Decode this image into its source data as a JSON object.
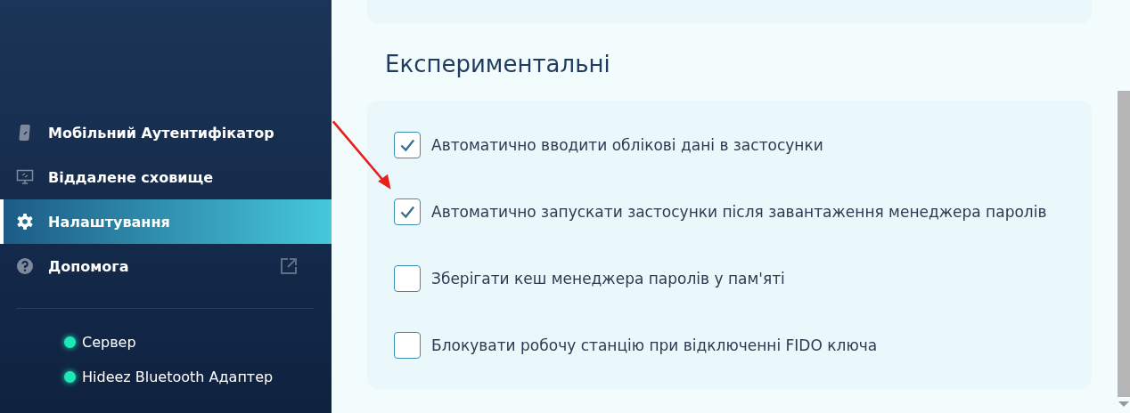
{
  "sidebar": {
    "items": [
      {
        "label": "Мобільний Аутентифікатор",
        "selected": false,
        "external": false
      },
      {
        "label": "Віддалене сховище",
        "selected": false,
        "external": false
      },
      {
        "label": "Налаштування",
        "selected": true,
        "external": false
      },
      {
        "label": "Допомога",
        "selected": false,
        "external": true
      }
    ],
    "status": [
      {
        "label": "Сервер",
        "color": "#1de9b6"
      },
      {
        "label": "Hideez Bluetooth Адаптер",
        "color": "#1de9b6"
      }
    ]
  },
  "section": {
    "title": "Експериментальні",
    "options": [
      {
        "label": "Автоматично вводити облікові дані в застосунки",
        "checked": true
      },
      {
        "label": "Автоматично запускати застосунки після завантаження менеджера паролів",
        "checked": true
      },
      {
        "label": "Зберігати кеш менеджера паролів у пам'яті",
        "checked": false
      },
      {
        "label": "Блокувати робочу станцію при відключенні FIDO ключа",
        "checked": false
      }
    ]
  }
}
